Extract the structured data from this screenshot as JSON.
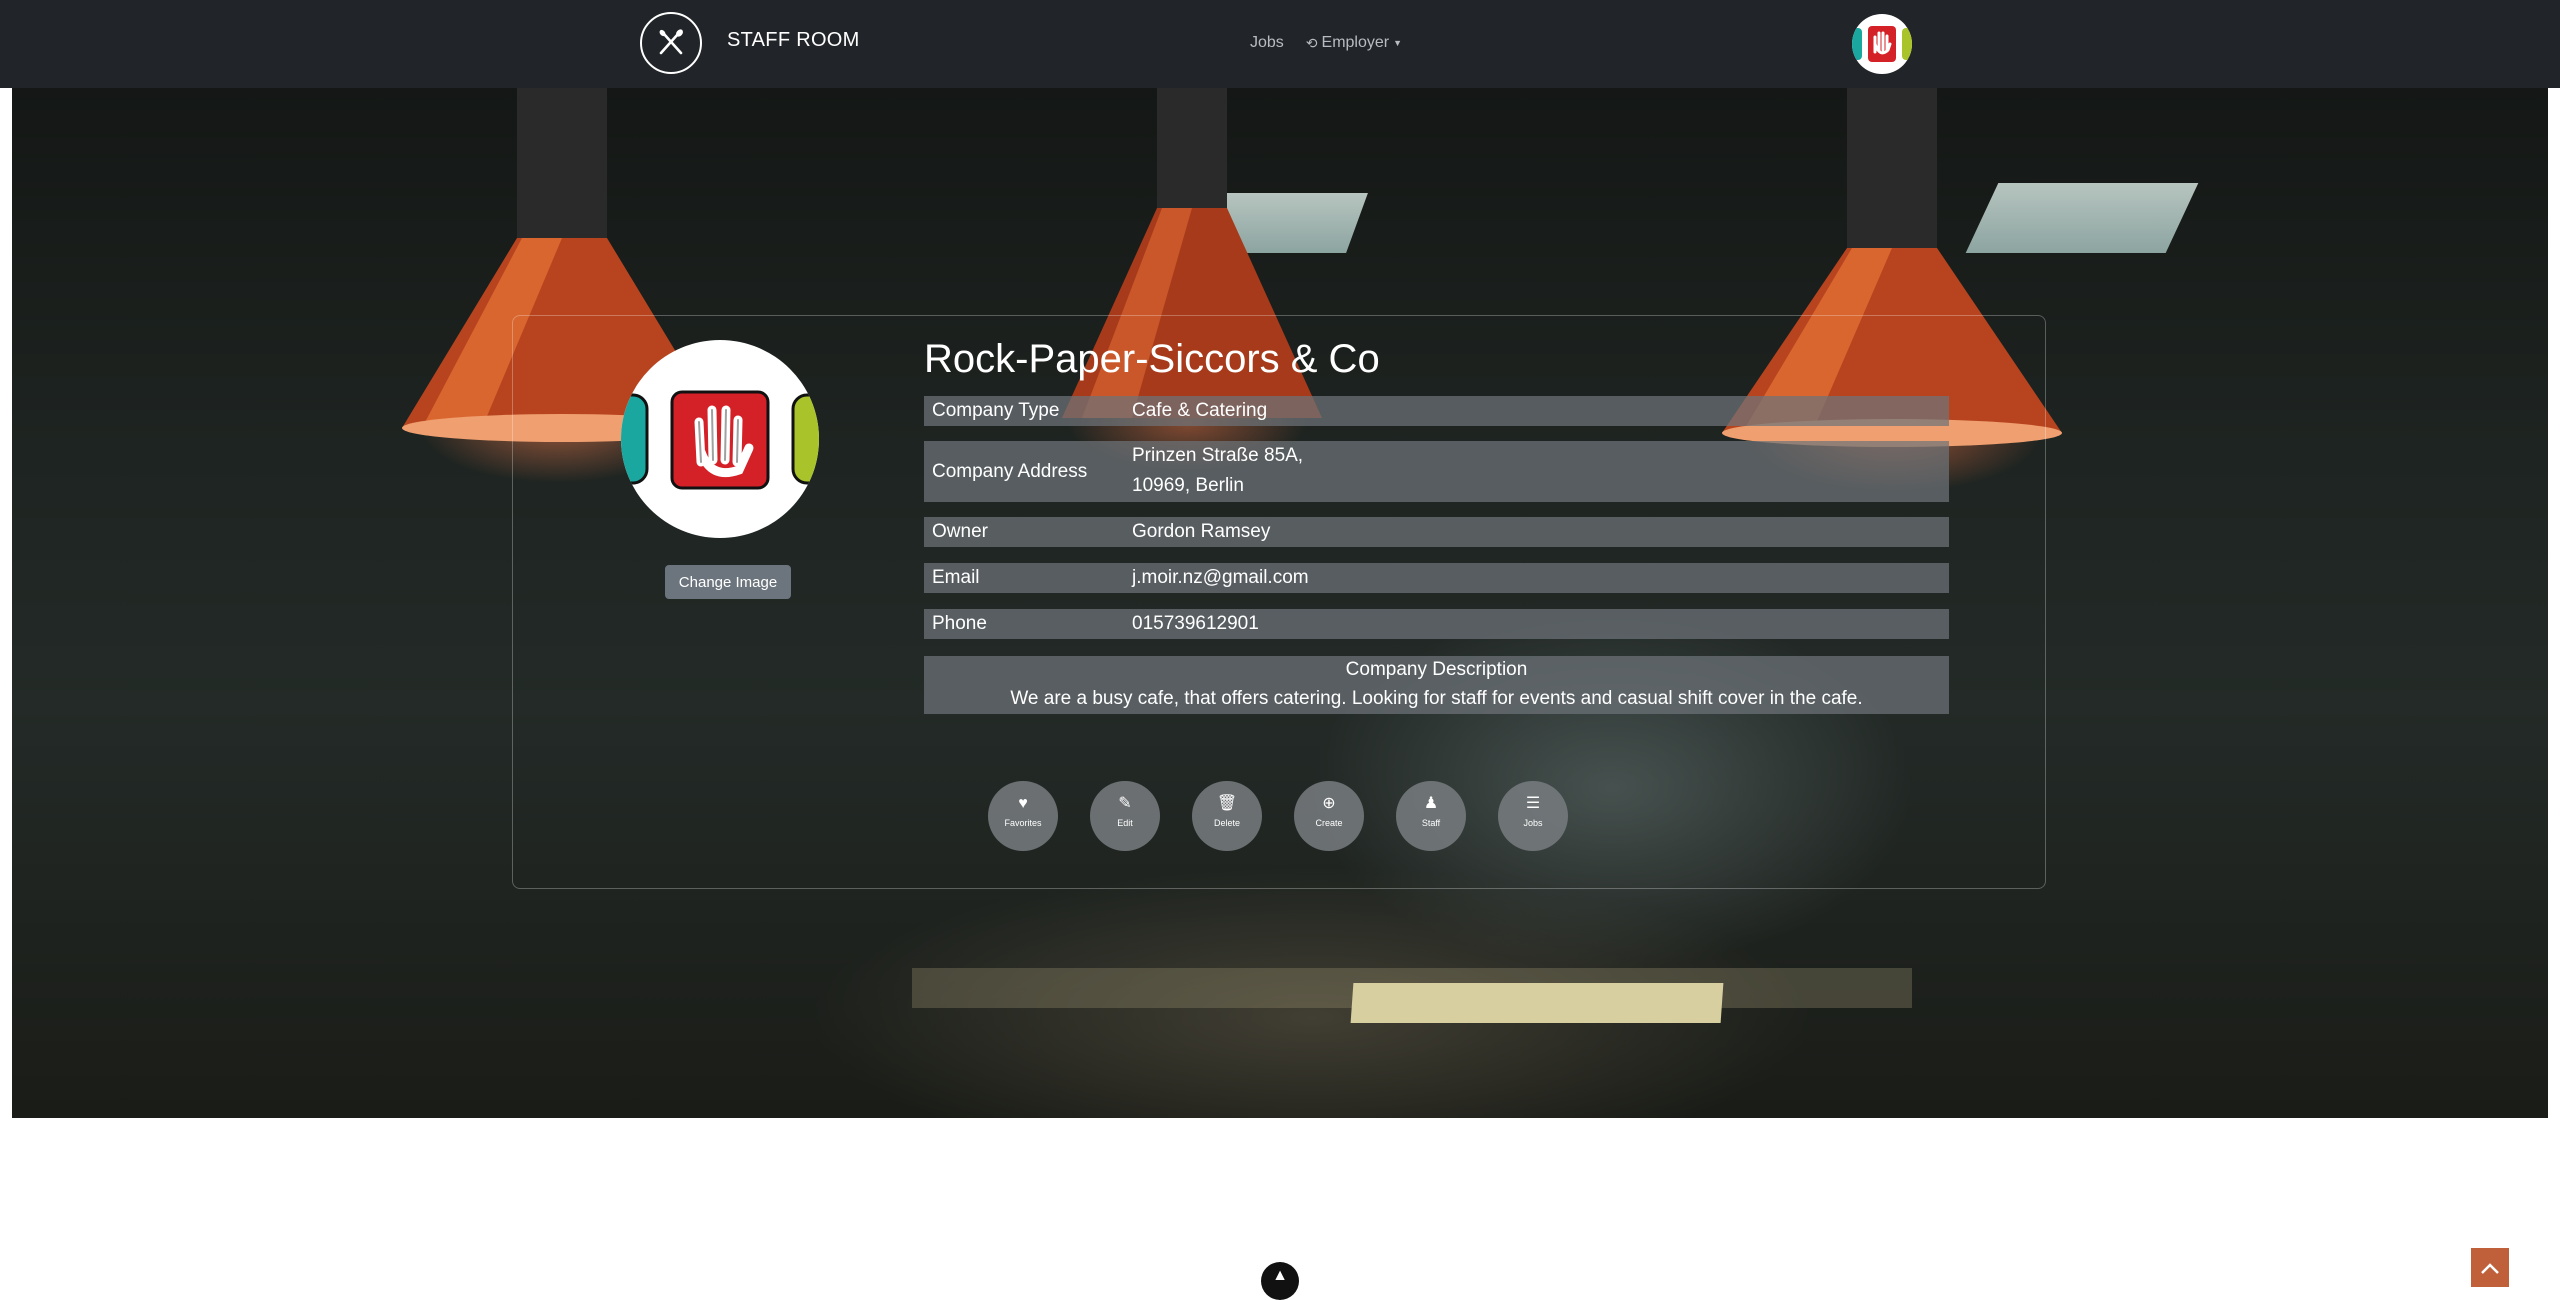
{
  "navbar": {
    "brand": "STAFF ROOM",
    "links": {
      "jobs": "Jobs",
      "employer": "Employer"
    }
  },
  "profile": {
    "company_name": "Rock-Paper-Siccors & Co",
    "change_image": "Change Image",
    "fields": {
      "type": {
        "label": "Company Type",
        "value": "Cafe & Catering"
      },
      "address": {
        "label": "Company Address",
        "line1": "Prinzen Straße 85A,",
        "line2": "10969, Berlin"
      },
      "owner": {
        "label": "Owner",
        "value": "Gordon Ramsey"
      },
      "email": {
        "label": "Email",
        "value": "j.moir.nz@gmail.com"
      },
      "phone": {
        "label": "Phone",
        "value": "015739612901"
      }
    },
    "description": {
      "title": "Company Description",
      "text": "We are a busy cafe, that offers catering. Looking for staff for events and casual shift cover in the cafe."
    }
  },
  "actions": {
    "favorites": "Favorites",
    "edit": "Edit",
    "delete": "Delete",
    "create": "Create",
    "staff": "Staff",
    "jobs": "Jobs"
  },
  "icons": {
    "brand": "crossed-utensils-icon",
    "employer": "history-icon",
    "favorites": "heart-icon",
    "edit": "pencil-icon",
    "delete": "trash-icon",
    "create": "plus-circle-icon",
    "staff": "person-icon",
    "jobs": "list-icon",
    "footer": "chevron-up-icon",
    "back_to_top": "chevron-up-icon"
  },
  "colors": {
    "navbar": "#212529",
    "row_bg": "#6e7378",
    "button_gray": "#6c757d",
    "back_to_top": "#c0603a",
    "logo_red": "#d42027",
    "logo_teal": "#1aa7a0",
    "logo_green": "#a9c42a"
  }
}
